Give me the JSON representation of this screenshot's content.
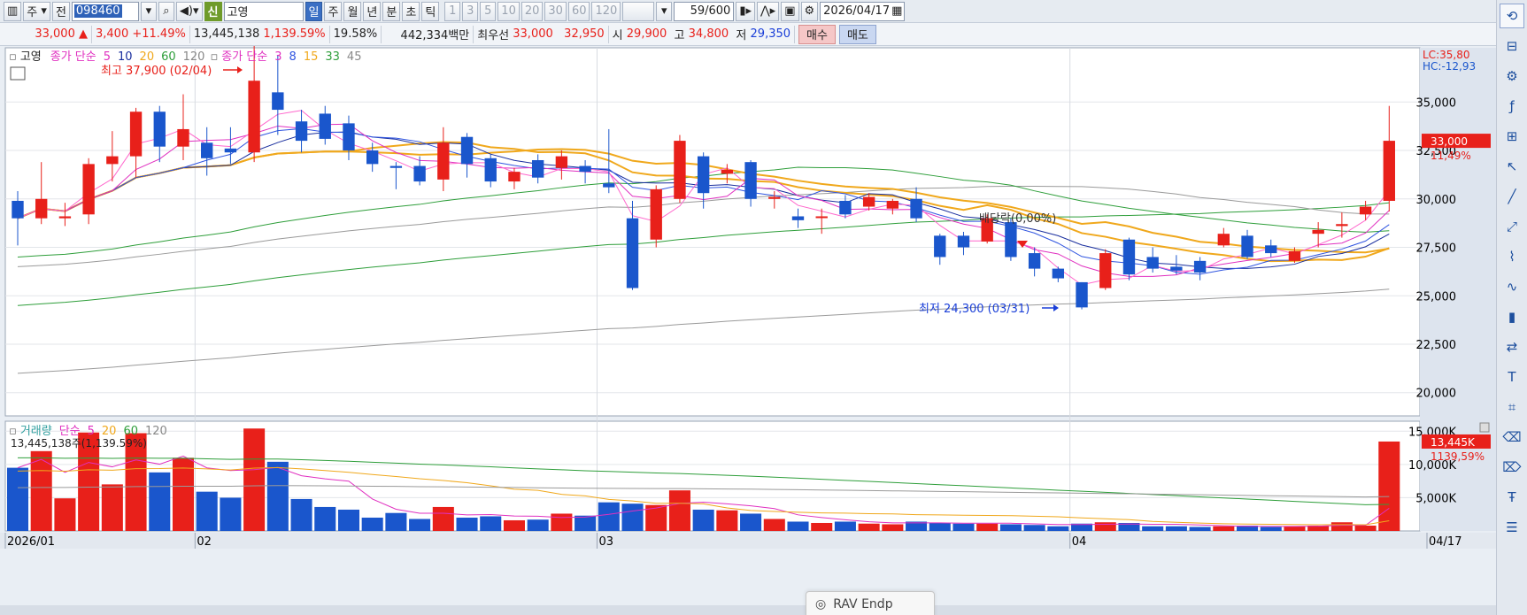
{
  "toolbar": {
    "market": "주",
    "prev": "전",
    "code": "098460",
    "shin": "신",
    "name": "고영",
    "periods": [
      "일",
      "주",
      "월",
      "년",
      "분",
      "초",
      "틱"
    ],
    "active_period": "일",
    "intervals": [
      "1",
      "3",
      "5",
      "10",
      "20",
      "30",
      "60",
      "120"
    ],
    "count": "59",
    "count_total": "/600",
    "date": "2026/04/17"
  },
  "quote": {
    "price": "33,000",
    "arrow": "▲",
    "change": "3,400",
    "change_pct": "+11.49%",
    "volume": "13,445,138",
    "volume_ratio": "1,139.59%",
    "turnover": "19.58%",
    "amount": "442,334백만",
    "bid_label": "최우선",
    "ask_price": "33,000",
    "bid_price": "32,950",
    "open_label": "시",
    "open": "29,900",
    "high_label": "고",
    "high": "34,800",
    "low_label": "저",
    "low": "29,350",
    "buy_label": "매수",
    "sell_label": "매도"
  },
  "legend": {
    "stock": "고영",
    "ma1_title": "종가 단순",
    "ma1_periods": [
      "5",
      "10",
      "20",
      "60",
      "120"
    ],
    "ma2_title": "종가 단순",
    "ma2_periods": [
      "3",
      "8",
      "15",
      "33",
      "45"
    ],
    "vol_title": "거래량",
    "vol_ma_title": "단순",
    "vol_periods": [
      "5",
      "20",
      "60",
      "120"
    ],
    "vol_readout": "13,445,138주(1,139.59%)"
  },
  "colors": {
    "up": "#e8201a",
    "down": "#1a56cc",
    "ma_orange": "#f0a81c",
    "ma_green": "#2e9e3a",
    "ma_gray": "#888888",
    "ma_magenta": "#e030c0",
    "ma_navy": "#1a2f9e"
  },
  "annotations": {
    "high_note": "최고 37,900 (02/04)",
    "low_note": "최저 24,300 (03/31)",
    "dividend": "배당락(0,00%)",
    "lc": "LC:35,80",
    "hc": "HC:-12,93",
    "price_tag": "33,000",
    "pct_tag": "11,49%",
    "vol_tag": "13,445K",
    "vol_pct_tag": "1139,59%"
  },
  "price_axis": [
    "35,000",
    "32,500",
    "30,000",
    "27,500",
    "25,000",
    "22,500",
    "20,000"
  ],
  "volume_axis": [
    "15,000K",
    "10,000K",
    "5,000K"
  ],
  "x_axis": [
    "2026/01",
    "02",
    "03",
    "04",
    "04/17"
  ],
  "popup_label": "RAV Endp",
  "chart_data": {
    "type": "candlestick",
    "ylim": [
      18800,
      37800
    ],
    "vol_ylim": [
      0,
      16500
    ],
    "candles": [
      {
        "o": 29900,
        "c": 29000,
        "h": 30400,
        "l": 27600,
        "v": 9500
      },
      {
        "o": 29000,
        "c": 30000,
        "h": 31900,
        "l": 28700,
        "v": 12000
      },
      {
        "o": 29000,
        "c": 29100,
        "h": 29800,
        "l": 28600,
        "v": 4900
      },
      {
        "o": 29200,
        "c": 31800,
        "h": 32100,
        "l": 28700,
        "v": 14800
      },
      {
        "o": 31800,
        "c": 32200,
        "h": 33500,
        "l": 30900,
        "v": 7000
      },
      {
        "o": 32200,
        "c": 34500,
        "h": 34700,
        "l": 31100,
        "v": 14700
      },
      {
        "o": 34500,
        "c": 32700,
        "h": 34800,
        "l": 31900,
        "v": 8800
      },
      {
        "o": 32700,
        "c": 33600,
        "h": 35400,
        "l": 32000,
        "v": 11000
      },
      {
        "o": 32900,
        "c": 32100,
        "h": 33700,
        "l": 31200,
        "v": 5900
      },
      {
        "o": 32600,
        "c": 32400,
        "h": 33700,
        "l": 31800,
        "v": 5000
      },
      {
        "o": 32400,
        "c": 36100,
        "h": 37900,
        "l": 31900,
        "v": 15400
      },
      {
        "o": 35500,
        "c": 34600,
        "h": 37400,
        "l": 33300,
        "v": 10400
      },
      {
        "o": 34000,
        "c": 33000,
        "h": 34600,
        "l": 32400,
        "v": 4800
      },
      {
        "o": 34400,
        "c": 33100,
        "h": 34800,
        "l": 32800,
        "v": 3600
      },
      {
        "o": 33900,
        "c": 32500,
        "h": 34300,
        "l": 32000,
        "v": 3200
      },
      {
        "o": 32500,
        "c": 31800,
        "h": 32900,
        "l": 31400,
        "v": 2000
      },
      {
        "o": 31700,
        "c": 31600,
        "h": 31900,
        "l": 30500,
        "v": 2700
      },
      {
        "o": 31700,
        "c": 30900,
        "h": 32200,
        "l": 30700,
        "v": 1800
      },
      {
        "o": 31000,
        "c": 32900,
        "h": 33700,
        "l": 30400,
        "v": 3600
      },
      {
        "o": 33200,
        "c": 31800,
        "h": 33400,
        "l": 31100,
        "v": 2000
      },
      {
        "o": 32100,
        "c": 30900,
        "h": 32300,
        "l": 30600,
        "v": 2200
      },
      {
        "o": 30900,
        "c": 31400,
        "h": 31600,
        "l": 30500,
        "v": 1600
      },
      {
        "o": 32000,
        "c": 31100,
        "h": 32300,
        "l": 30800,
        "v": 1700
      },
      {
        "o": 31600,
        "c": 32200,
        "h": 32500,
        "l": 31000,
        "v": 2600
      },
      {
        "o": 31700,
        "c": 31400,
        "h": 32000,
        "l": 30800,
        "v": 2300
      },
      {
        "o": 30800,
        "c": 30600,
        "h": 33600,
        "l": 30300,
        "v": 4300
      },
      {
        "o": 29000,
        "c": 25400,
        "h": 29900,
        "l": 25300,
        "v": 4100
      },
      {
        "o": 27900,
        "c": 30500,
        "h": 30700,
        "l": 27500,
        "v": 3900
      },
      {
        "o": 30000,
        "c": 33000,
        "h": 33300,
        "l": 29800,
        "v": 6100
      },
      {
        "o": 32200,
        "c": 30300,
        "h": 32400,
        "l": 29500,
        "v": 3200
      },
      {
        "o": 31300,
        "c": 31500,
        "h": 31800,
        "l": 30800,
        "v": 3100
      },
      {
        "o": 31900,
        "c": 30000,
        "h": 32000,
        "l": 29600,
        "v": 2600
      },
      {
        "o": 30000,
        "c": 30100,
        "h": 30400,
        "l": 29500,
        "v": 1800
      },
      {
        "o": 29100,
        "c": 28900,
        "h": 29500,
        "l": 28500,
        "v": 1400
      },
      {
        "o": 29100,
        "c": 29100,
        "h": 29500,
        "l": 28200,
        "v": 1200
      },
      {
        "o": 29900,
        "c": 29200,
        "h": 30200,
        "l": 29000,
        "v": 1400
      },
      {
        "o": 29600,
        "c": 30100,
        "h": 30300,
        "l": 29400,
        "v": 1100
      },
      {
        "o": 29500,
        "c": 29900,
        "h": 30000,
        "l": 29200,
        "v": 1000
      },
      {
        "o": 30000,
        "c": 29000,
        "h": 30600,
        "l": 28800,
        "v": 1400
      },
      {
        "o": 28100,
        "c": 27000,
        "h": 28200,
        "l": 26600,
        "v": 1200
      },
      {
        "o": 28100,
        "c": 27500,
        "h": 28300,
        "l": 27100,
        "v": 1100
      },
      {
        "o": 27800,
        "c": 29000,
        "h": 29200,
        "l": 27700,
        "v": 1100
      },
      {
        "o": 28800,
        "c": 27000,
        "h": 29000,
        "l": 26800,
        "v": 1000
      },
      {
        "o": 27200,
        "c": 26400,
        "h": 27500,
        "l": 26000,
        "v": 900
      },
      {
        "o": 26400,
        "c": 25900,
        "h": 26500,
        "l": 25700,
        "v": 700
      },
      {
        "o": 25700,
        "c": 24400,
        "h": 25700,
        "l": 24300,
        "v": 1100
      },
      {
        "o": 25400,
        "c": 27200,
        "h": 27400,
        "l": 25300,
        "v": 1300
      },
      {
        "o": 27900,
        "c": 26100,
        "h": 28000,
        "l": 25800,
        "v": 1200
      },
      {
        "o": 27000,
        "c": 26400,
        "h": 27500,
        "l": 26200,
        "v": 700
      },
      {
        "o": 26500,
        "c": 26300,
        "h": 27100,
        "l": 26100,
        "v": 700
      },
      {
        "o": 26800,
        "c": 26200,
        "h": 27000,
        "l": 25800,
        "v": 600
      },
      {
        "o": 27600,
        "c": 28200,
        "h": 28500,
        "l": 27500,
        "v": 700
      },
      {
        "o": 28100,
        "c": 27000,
        "h": 28400,
        "l": 26900,
        "v": 800
      },
      {
        "o": 27600,
        "c": 27200,
        "h": 27900,
        "l": 27000,
        "v": 600
      },
      {
        "o": 26800,
        "c": 27300,
        "h": 27500,
        "l": 26700,
        "v": 700
      },
      {
        "o": 28200,
        "c": 28400,
        "h": 28800,
        "l": 27500,
        "v": 800
      },
      {
        "o": 28600,
        "c": 28700,
        "h": 29300,
        "l": 28000,
        "v": 1300
      },
      {
        "o": 29200,
        "c": 29600,
        "h": 29900,
        "l": 28900,
        "v": 800
      },
      {
        "o": 29900,
        "c": 33000,
        "h": 34800,
        "l": 29350,
        "v": 13445
      }
    ]
  }
}
